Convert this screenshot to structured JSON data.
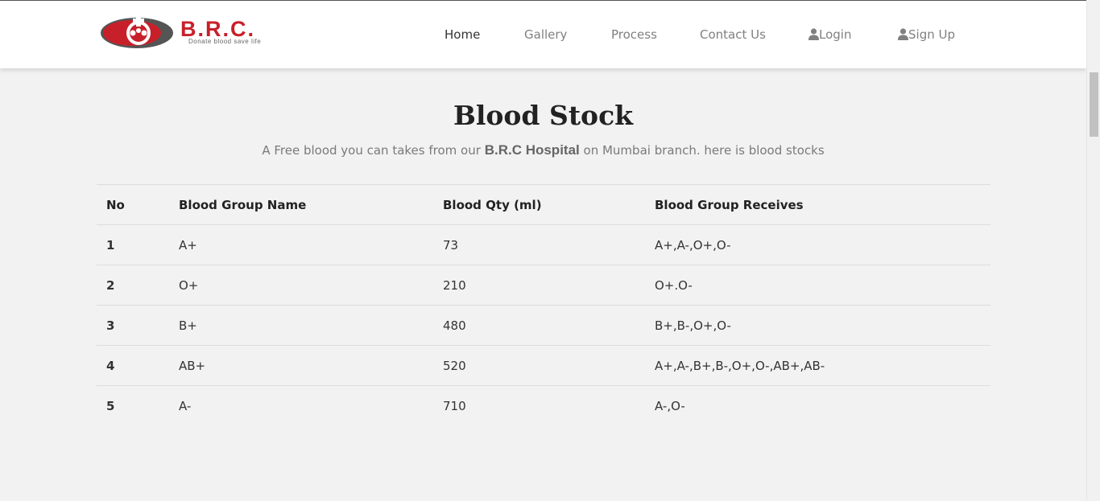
{
  "brand": {
    "name": "B.R.C.",
    "tagline": "Donate blood save life",
    "color": "#c8202a"
  },
  "nav": {
    "items": [
      {
        "label": "Home",
        "active": true
      },
      {
        "label": "Gallery"
      },
      {
        "label": "Process"
      },
      {
        "label": "Contact Us"
      },
      {
        "label": "Login",
        "icon": "user-icon"
      },
      {
        "label": "Sign Up",
        "icon": "user-icon"
      }
    ]
  },
  "page": {
    "title": "Blood Stock",
    "subtitle_prefix": "A Free blood you can takes from our",
    "subtitle_strong": "B.R.C Hospital",
    "subtitle_suffix": "on Mumbai branch. here is blood stocks"
  },
  "table": {
    "headers": [
      "No",
      "Blood Group Name",
      "Blood Qty (ml)",
      "Blood Group Receives"
    ],
    "rows": [
      [
        "1",
        "A+",
        "73",
        "A+,A-,O+,O-"
      ],
      [
        "2",
        "O+",
        "210",
        "O+.O-"
      ],
      [
        "3",
        "B+",
        "480",
        "B+,B-,O+,O-"
      ],
      [
        "4",
        "AB+",
        "520",
        "A+,A-,B+,B-,O+,O-,AB+,AB-"
      ],
      [
        "5",
        "A-",
        "710",
        "A-,O-"
      ]
    ]
  }
}
